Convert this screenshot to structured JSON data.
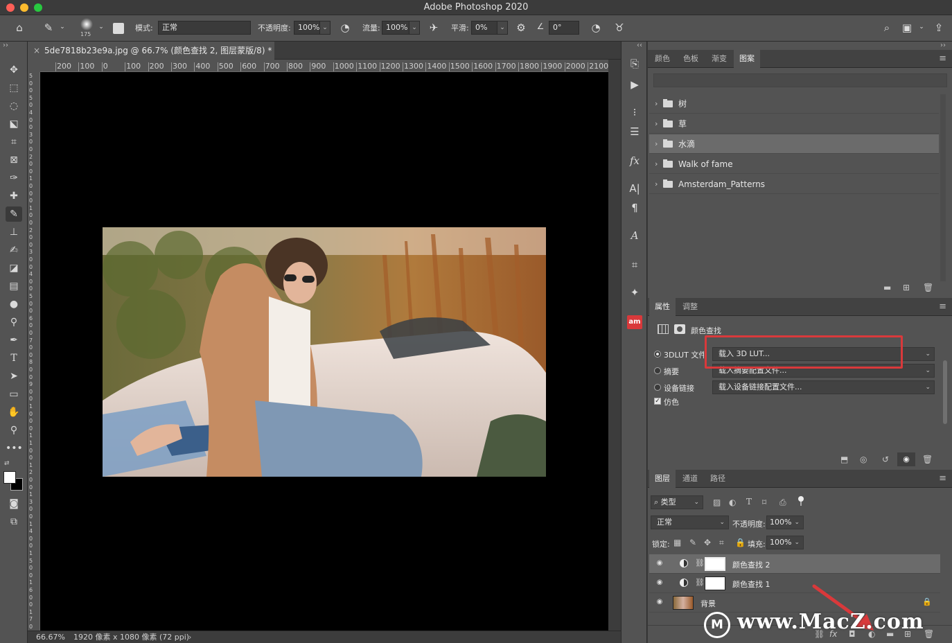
{
  "app": {
    "title": "Adobe Photoshop 2020"
  },
  "colors": {
    "accent_red": "#d9393b",
    "panel_bg": "#535353",
    "canvas_bg": "#000000"
  },
  "options_bar": {
    "brush_size": "175",
    "mode_label": "模式:",
    "mode_value": "正常",
    "opacity_label": "不透明度:",
    "opacity_value": "100%",
    "flow_label": "流量:",
    "flow_value": "100%",
    "smoothing_label": "平滑:",
    "smoothing_value": "0%",
    "angle_value": "0°"
  },
  "document": {
    "tab_title": "5de7818b23e9a.jpg @ 66.7% (颜色查找 2, 图层蒙版/8) *",
    "close_glyph": "×",
    "zoom": "66.67%",
    "dimensions": "1920 像素 x 1080 像素 (72 ppi)",
    "ruler_ticks": [
      "200",
      "100",
      "0",
      "100",
      "200",
      "300",
      "400",
      "500",
      "600",
      "700",
      "800",
      "900",
      "1000",
      "1100",
      "1200",
      "1300",
      "1400",
      "1500",
      "1600",
      "1700",
      "1800",
      "1900",
      "2000",
      "2100"
    ],
    "vruler_ticks": [
      "5",
      "0",
      "0",
      "5",
      "0",
      "4",
      "0",
      "0",
      "3",
      "0",
      "0",
      "2",
      "0",
      "0",
      "1",
      "0",
      "0",
      "0",
      "1",
      "0",
      "0",
      "2",
      "0",
      "0",
      "3",
      "0",
      "0",
      "4",
      "0",
      "0",
      "5",
      "0",
      "0",
      "6",
      "0",
      "0",
      "7",
      "0",
      "0",
      "8",
      "0",
      "0",
      "9",
      "0",
      "0",
      "1",
      "0",
      "0",
      "0",
      "1",
      "1",
      "0",
      "0",
      "1",
      "2",
      "0",
      "0",
      "1",
      "3",
      "0",
      "0",
      "1",
      "4",
      "0",
      "0",
      "1",
      "5",
      "0",
      "0",
      "1",
      "6",
      "0",
      "0",
      "1",
      "7",
      "0"
    ]
  },
  "patterns_panel": {
    "tabs": [
      "颜色",
      "色板",
      "渐变",
      "图案"
    ],
    "selected_tab": "图案",
    "groups": [
      {
        "label": "树",
        "selected": false
      },
      {
        "label": "草",
        "selected": false
      },
      {
        "label": "水滴",
        "selected": true
      },
      {
        "label": "Walk of fame",
        "selected": false
      },
      {
        "label": "Amsterdam_Patterns",
        "selected": false
      }
    ]
  },
  "properties_panel": {
    "tabs": [
      "属性",
      "调整"
    ],
    "selected_tab": "属性",
    "header_label": "颜色查找",
    "rows": [
      {
        "label": "3DLUT 文件",
        "value": "载入 3D LUT...",
        "checked": true
      },
      {
        "label": "摘要",
        "value": "载入摘要配置文件...",
        "checked": false
      },
      {
        "label": "设备链接",
        "value": "载入设备链接配置文件...",
        "checked": false
      }
    ],
    "dither_label": "仿色",
    "dither_checked": true
  },
  "layers_panel": {
    "tabs": [
      "图层",
      "通道",
      "路径"
    ],
    "selected_tab": "图层",
    "filter_label": "类型",
    "blend_mode": "正常",
    "opacity_label": "不透明度:",
    "opacity_value": "100%",
    "lock_label": "锁定:",
    "fill_label": "填充:",
    "fill_value": "100%",
    "layers": [
      {
        "name": "颜色查找 2",
        "selected": true
      },
      {
        "name": "颜色查找 1",
        "selected": false
      },
      {
        "name": "背景",
        "selected": false
      }
    ]
  },
  "watermark": {
    "text": "www.MacZ.com"
  }
}
